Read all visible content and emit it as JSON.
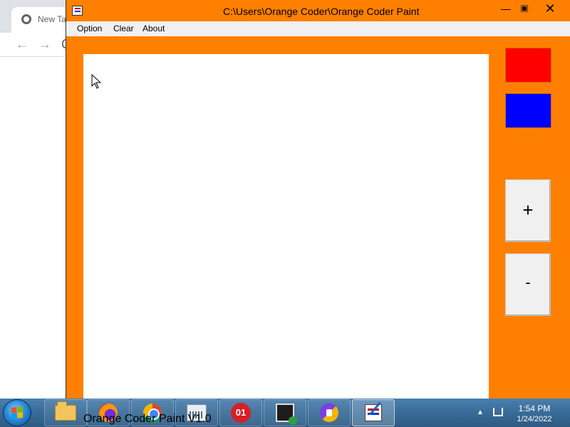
{
  "browser": {
    "tab_title": "New Tab",
    "tab_close_glyph": "✕",
    "new_tab_glyph": "+",
    "back_glyph": "←",
    "forward_glyph": "→",
    "reload_glyph": "C"
  },
  "app": {
    "window_title": "C:\\Users\\Orange Coder\\Orange Coder Paint",
    "window_controls": {
      "minimize_glyph": "—",
      "maximize_glyph": "▣",
      "close_glyph": "✕"
    },
    "menu": {
      "option": "Option",
      "clear": "Clear",
      "about": "About"
    },
    "palette": {
      "colors": [
        "#ff0000",
        "#0000ff"
      ]
    },
    "brush_controls": {
      "increase_label": "+",
      "decrease_label": "-"
    },
    "background_color": "#ff8000"
  },
  "taskbar": {
    "label_text": "Orange Coder Paint V1.0",
    "oneapp_text": "01",
    "pinned_icons": [
      "explorer-icon",
      "firefox-icon",
      "chrome-icon",
      "media-icon",
      "oneapp-icon",
      "program-icon",
      "vpn-icon",
      "paint-icon"
    ],
    "tray": {
      "arrow_glyph": "▲",
      "time": "1:54 PM",
      "date": "1/24/2022"
    }
  }
}
